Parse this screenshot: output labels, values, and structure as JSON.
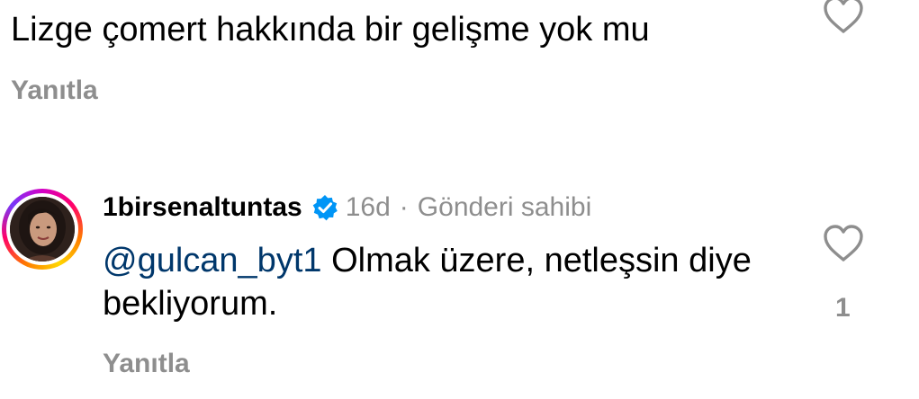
{
  "comment1": {
    "text": "Lizge çomert hakkında bir gelişme yok mu",
    "reply_label": "Yanıtla"
  },
  "comment2": {
    "username": "1birsenaltuntas",
    "time": "16d",
    "separator": "·",
    "badge": "Gönderi sahibi",
    "mention": "@gulcan_byt1",
    "text": " Olmak üzere, netleşsin diye bekliyorum.",
    "like_count": "1",
    "reply_label": "Yanıtla"
  },
  "icons": {
    "like": "heart-outline-icon",
    "verified": "verified-badge-icon"
  },
  "colors": {
    "muted": "#8e8e8e",
    "mention": "#00376b",
    "verified": "#0095f6"
  }
}
